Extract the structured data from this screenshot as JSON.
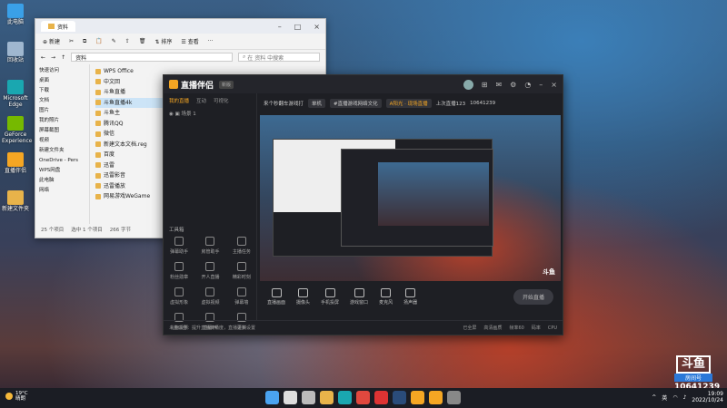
{
  "desktop": {
    "icons": [
      {
        "name": "this-pc",
        "label": "此电脑",
        "color": "#3aa0e8"
      },
      {
        "name": "recycle-bin",
        "label": "回收站",
        "color": "#9fb7cf"
      },
      {
        "name": "edge",
        "label": "Microsoft Edge",
        "color": "#1aa7b0"
      },
      {
        "name": "nvidia",
        "label": "GeForce Experience",
        "color": "#76b900"
      },
      {
        "name": "app",
        "label": "直播伴侣",
        "color": "#f5a623"
      },
      {
        "name": "folder",
        "label": "新建文件夹",
        "color": "#e8b34a"
      }
    ]
  },
  "explorer": {
    "tab_title": "资料",
    "toolbar": {
      "new": "新建",
      "sort": "排序",
      "view": "查看"
    },
    "address": "资料",
    "search_placeholder": "在 资料 中搜索",
    "nav": [
      "快速访问",
      "桌面",
      "下载",
      "文档",
      "图片",
      "我的照片",
      "屏幕截图",
      "视频",
      "新建文件夹",
      "OneDrive - Pers",
      "WPS网盘",
      "此电脑",
      "网络"
    ],
    "files": [
      "WPS Office",
      "中文回",
      "斗鱼直播",
      "斗鱼直播4k",
      "斗鱼主",
      "腾讯QQ",
      "微信",
      "新建文本文档.reg",
      "百度",
      "迅雷",
      "迅雷影音",
      "迅雷播放",
      "网易游戏WeGame"
    ],
    "status": {
      "items": "25 个项目",
      "selected": "选中 1 个项目",
      "size": "266 字节"
    }
  },
  "app": {
    "logo": "直播伴侣",
    "version": "新版",
    "tabs": [
      "我的直播",
      "互动",
      "可视化"
    ],
    "scene": "场景 1",
    "room_title": "来个秒翻车游戏打",
    "room_tag1": "单机",
    "room_tag2": "#直播游戏网络文化",
    "room_tag3": "A阳光 · 现场直播",
    "room_fans": "上次直播123",
    "room_id": "10641239",
    "tools_title": "工具箱",
    "tools": [
      "弹幕助手",
      "房管助手",
      "主播任务",
      "粉丝勋章",
      "开人直播",
      "精彩时刻",
      "虚拟形象",
      "虚拟视频",
      "弹幕墙",
      "礼物投票",
      "直播PK",
      "更多"
    ],
    "controls": [
      "直播画面",
      "摄像头",
      "手机投屏",
      "游戏窗口",
      "麦克风",
      "扬声器"
    ],
    "start_button": "开始直播",
    "bottom": [
      "斗鱼公告：提升直播流畅度，直播录制设置",
      "已全屏",
      "高清画质",
      "帧率60",
      "码率",
      "CPU"
    ],
    "brand": "斗鱼"
  },
  "watermark": {
    "logo": "斗鱼",
    "sub": "房间号",
    "room": "10641239"
  },
  "taskbar": {
    "weather_temp": "19°C",
    "weather_desc": "晴朗",
    "icons": [
      "start",
      "search",
      "task-view",
      "file-explorer",
      "edge",
      "chrome",
      "wps",
      "steam",
      "douyu",
      "app",
      "settings"
    ],
    "lang": "英",
    "time": "19:09",
    "date": "2022/10/24"
  }
}
